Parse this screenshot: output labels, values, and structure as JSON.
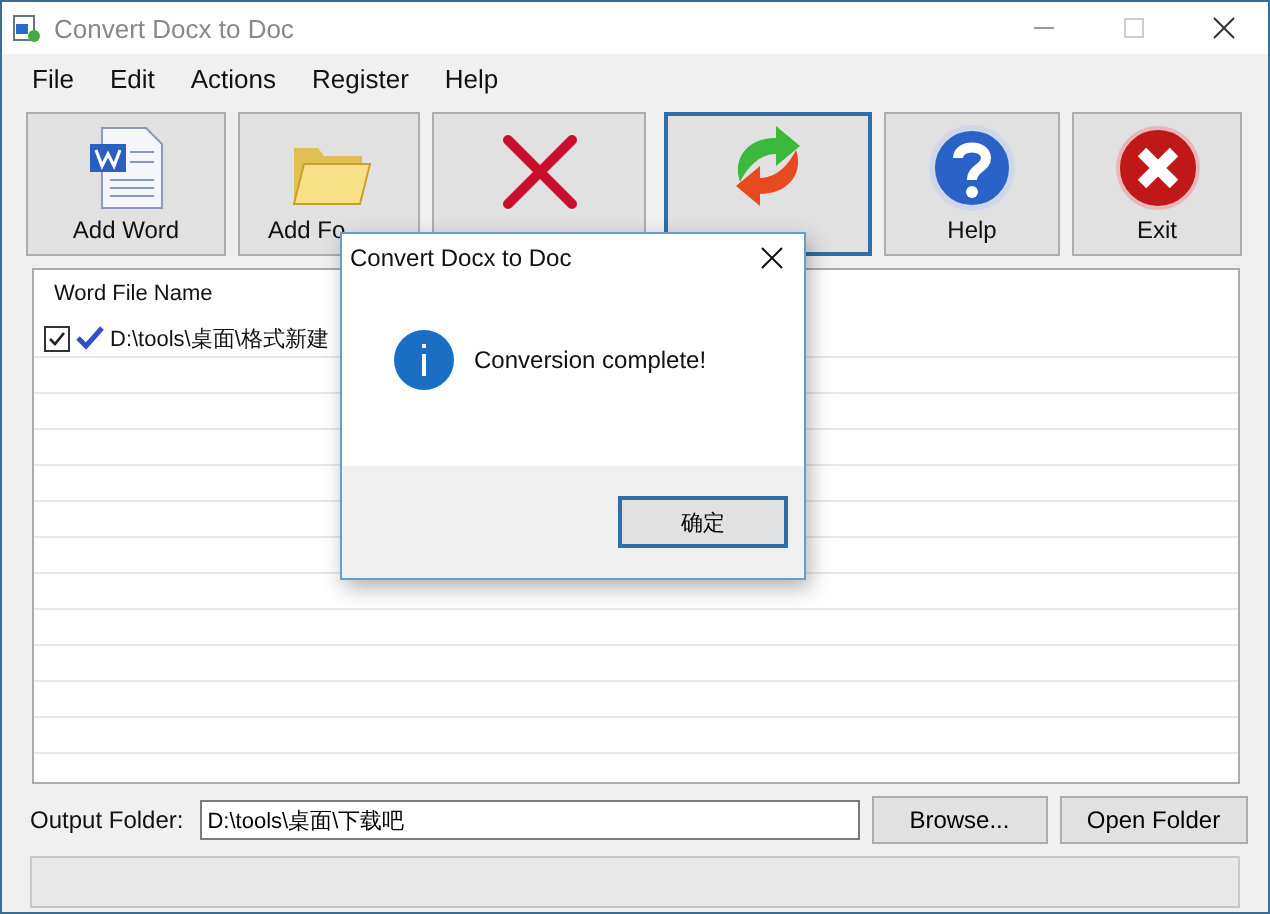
{
  "window": {
    "title": "Convert Docx to Doc"
  },
  "menu": [
    "File",
    "Edit",
    "Actions",
    "Register",
    "Help"
  ],
  "toolbar": [
    {
      "kind": "word",
      "label": "Add Word",
      "selected": false
    },
    {
      "kind": "folder",
      "label": "Add Fo",
      "selected": false
    },
    {
      "kind": "remove",
      "selected": false
    },
    {
      "kind": "convert",
      "selected": true
    },
    {
      "kind": "help",
      "label": "Help",
      "selected": false
    },
    {
      "kind": "exit",
      "label": "Exit",
      "selected": false
    }
  ],
  "file_list": {
    "column": "Word File Name",
    "rows": [
      {
        "checked": true,
        "path": "D:\\tools\\桌面\\格式新建"
      }
    ]
  },
  "output": {
    "label": "Output Folder:",
    "value": "D:\\tools\\桌面\\下载吧",
    "buttons": [
      "Browse...",
      "Open Folder"
    ]
  },
  "dialog": {
    "title": "Convert Docx to Doc",
    "message": "Conversion complete!",
    "button": "确定"
  }
}
